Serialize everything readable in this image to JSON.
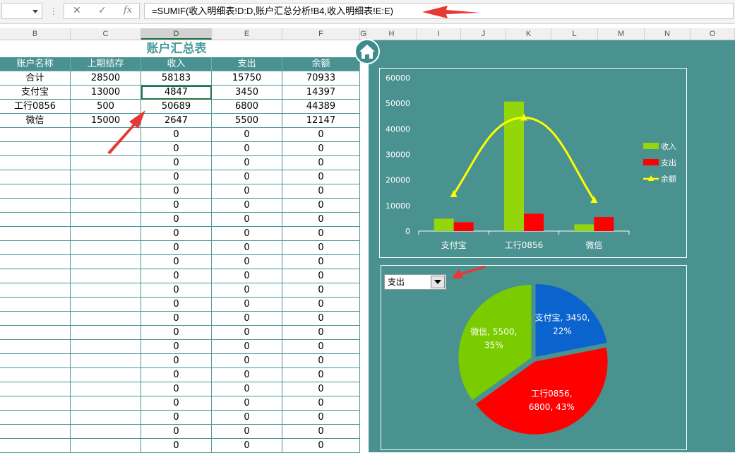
{
  "formula_bar": {
    "name_box": "",
    "cancel_icon": "✕",
    "enter_icon": "✓",
    "fx_label": "fx",
    "formula": "=SUMIF(收入明细表!D:D,账户汇总分析!B4,收入明细表!E:E)"
  },
  "columns": [
    "B",
    "C",
    "D",
    "E",
    "F",
    "G",
    "H",
    "I",
    "J",
    "K",
    "L",
    "M",
    "N",
    "O"
  ],
  "selected_column": "D",
  "sheet_title": "账户汇总表",
  "table": {
    "headers": [
      "账户名称",
      "上期结存",
      "收入",
      "支出",
      "余额"
    ],
    "rows": [
      [
        "合计",
        "28500",
        "58183",
        "15750",
        "70933"
      ],
      [
        "支付宝",
        "13000",
        "4847",
        "3450",
        "14397"
      ],
      [
        "工行0856",
        "500",
        "50689",
        "6800",
        "44389"
      ],
      [
        "微信",
        "15000",
        "2647",
        "5500",
        "12147"
      ]
    ],
    "empty_row_value": "0",
    "empty_row_count": 23,
    "active_cell": "D4"
  },
  "dashboard": {
    "home_icon": "home-icon",
    "dropdown_value": "支出",
    "colors": {
      "panel": "#4a9290",
      "income": "#92d60b",
      "expense": "#ff0000",
      "balance": "#ffff00",
      "pie_blue": "#0b63ce",
      "pie_red": "#ff0000",
      "pie_green": "#7acc00"
    }
  },
  "chart_data": [
    {
      "type": "bar",
      "categories": [
        "支付宝",
        "工行0856",
        "微信"
      ],
      "series": [
        {
          "name": "收入",
          "type": "bar",
          "values": [
            4847,
            50689,
            2647
          ]
        },
        {
          "name": "支出",
          "type": "bar",
          "values": [
            3450,
            6800,
            5500
          ]
        },
        {
          "name": "余额",
          "type": "line",
          "values": [
            14397,
            44389,
            12147
          ]
        }
      ],
      "ylim": [
        0,
        60000
      ],
      "yticks": [
        "0",
        "10000",
        "20000",
        "30000",
        "40000",
        "50000",
        "60000"
      ],
      "legend": "right"
    },
    {
      "type": "pie",
      "labels": [
        "支付宝",
        "工行0856",
        "微信"
      ],
      "values": [
        3450,
        6800,
        5500
      ],
      "percents": [
        "22%",
        "43%",
        "35%"
      ],
      "data_labels": [
        [
          "支付宝, 3450,",
          "22%"
        ],
        [
          "工行0856,",
          "6800, 43%"
        ],
        [
          "微信, 5500,",
          "35%"
        ]
      ]
    }
  ]
}
